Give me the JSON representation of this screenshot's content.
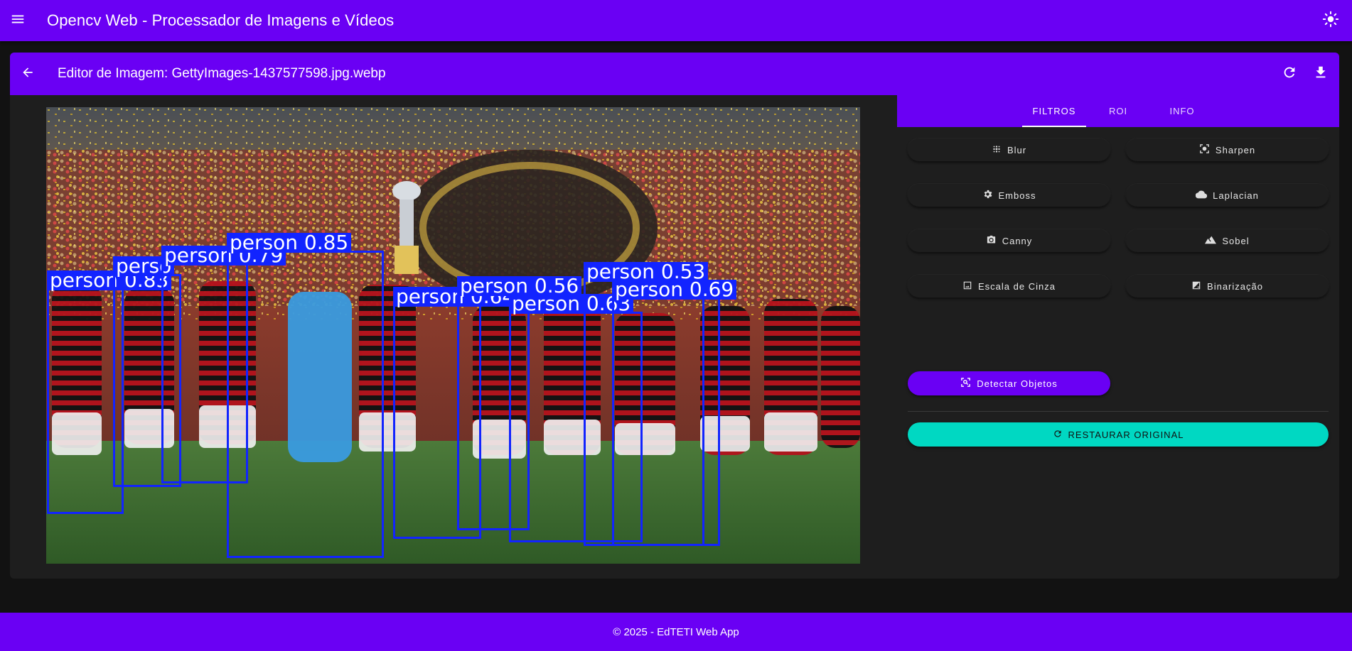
{
  "app": {
    "title": "Opencv Web - Processador de Imagens e Vídeos",
    "menu_icon": "menu-icon",
    "theme_icon": "sun-icon"
  },
  "editor": {
    "title": "Editor de Imagem: GettyImages-1437577598.jpg.webp",
    "back_icon": "arrow-left-icon",
    "refresh_icon": "refresh-icon",
    "download_icon": "download-icon"
  },
  "image": {
    "detections": [
      {
        "label": "person 0.83"
      },
      {
        "label": "perso"
      },
      {
        "label": "person 0.79"
      },
      {
        "label": "person 0.85"
      },
      {
        "label": "person 0.64"
      },
      {
        "label": "person 0.56"
      },
      {
        "label": "person 0.63"
      },
      {
        "label": "person 0.53"
      },
      {
        "label": "person 0.69"
      }
    ]
  },
  "panel": {
    "tabs": [
      {
        "label": "FILTROS",
        "active": true
      },
      {
        "label": "ROI",
        "active": false
      },
      {
        "label": "INFO",
        "active": false
      }
    ],
    "filters": [
      {
        "label": "Blur",
        "icon": "blur-icon"
      },
      {
        "label": "Sharpen",
        "icon": "focus-icon"
      },
      {
        "label": "Emboss",
        "icon": "gear-icon"
      },
      {
        "label": "Laplacian",
        "icon": "cloud-icon"
      },
      {
        "label": "Canny",
        "icon": "camera-icon"
      },
      {
        "label": "Sobel",
        "icon": "mountain-icon"
      },
      {
        "label": "Escala de Cinza",
        "icon": "image-icon"
      },
      {
        "label": "Binarização",
        "icon": "contrast-icon"
      }
    ],
    "detect_button": {
      "label": "Detectar Objetos",
      "icon": "scan-icon"
    },
    "restore_button": {
      "label": "RESTAURAR ORIGINAL",
      "icon": "restore-icon"
    }
  },
  "footer": {
    "text": "© 2025 - EdTETI Web App"
  },
  "colors": {
    "primary": "#6a00f4",
    "accent": "#00d8c2",
    "background": "#121212",
    "surface": "#1e1e1e",
    "detection_box": "#1224ff"
  }
}
